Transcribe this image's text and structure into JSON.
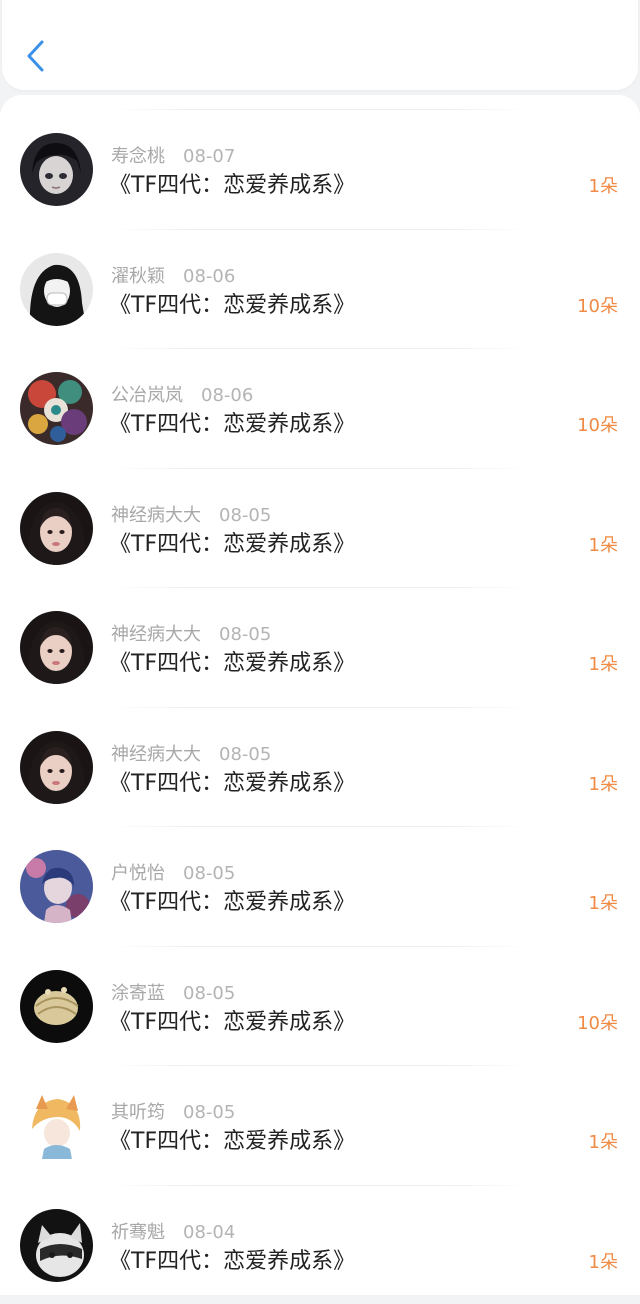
{
  "header": {
    "back_icon": "chevron-left-icon",
    "accent_color": "#3a8fe8"
  },
  "colors": {
    "count": "#f08a45",
    "meta": "#a8a8a8",
    "title": "#222222"
  },
  "records": [
    {
      "name": "寿念桃",
      "date": "08-07",
      "title": "《TF四代：恋爱养成系》",
      "count": "1朵",
      "avatar": "avatar-anime-girl-dark"
    },
    {
      "name": "濯秋颖",
      "date": "08-06",
      "title": "《TF四代：恋爱养成系》",
      "count": "10朵",
      "avatar": "avatar-girl-mask-bw"
    },
    {
      "name": "公冶岚岚",
      "date": "08-06",
      "title": "《TF四代：恋爱养成系》",
      "count": "10朵",
      "avatar": "avatar-colorful-collage"
    },
    {
      "name": "神经病大大",
      "date": "08-05",
      "title": "《TF四代：恋爱养成系》",
      "count": "1朵",
      "avatar": "avatar-girl-portrait"
    },
    {
      "name": "神经病大大",
      "date": "08-05",
      "title": "《TF四代：恋爱养成系》",
      "count": "1朵",
      "avatar": "avatar-girl-portrait"
    },
    {
      "name": "神经病大大",
      "date": "08-05",
      "title": "《TF四代：恋爱养成系》",
      "count": "1朵",
      "avatar": "avatar-girl-portrait"
    },
    {
      "name": "户悦怡",
      "date": "08-05",
      "title": "《TF四代：恋爱养成系》",
      "count": "1朵",
      "avatar": "avatar-anime-blue"
    },
    {
      "name": "涂寄蓝",
      "date": "08-05",
      "title": "《TF四代：恋爱养成系》",
      "count": "10朵",
      "avatar": "avatar-seashell-dark"
    },
    {
      "name": "其听筠",
      "date": "08-05",
      "title": "《TF四代：恋爱养成系》",
      "count": "1朵",
      "avatar": "avatar-anime-blond"
    },
    {
      "name": "祈骞魁",
      "date": "08-04",
      "title": "《TF四代：恋爱养成系》",
      "count": "1朵",
      "avatar": "avatar-cat-bw"
    }
  ]
}
